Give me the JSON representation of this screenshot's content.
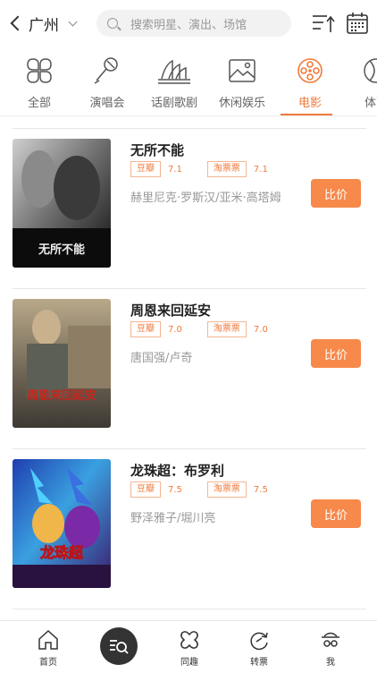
{
  "header": {
    "city": "广州",
    "search_placeholder": "搜索明星、演出、场馆"
  },
  "categories": [
    {
      "label": "全部",
      "icon": "grid-icon"
    },
    {
      "label": "演唱会",
      "icon": "microphone-icon"
    },
    {
      "label": "话剧歌剧",
      "icon": "opera-house-icon"
    },
    {
      "label": "休闲娱乐",
      "icon": "image-icon"
    },
    {
      "label": "电影",
      "icon": "film-reel-icon",
      "active": true
    },
    {
      "label": "体育",
      "icon": "ball-icon"
    }
  ],
  "movies": [
    {
      "title": "无所不能",
      "rating1_source": "豆瓣",
      "rating1_value": "7.1",
      "rating2_source": "淘票票",
      "rating2_value": "7.1",
      "cast": "赫里尼克·罗斯汉/亚米·高塔姆",
      "button": "比价",
      "poster_text": "无所不能"
    },
    {
      "title": "周恩来回延安",
      "rating1_source": "豆瓣",
      "rating1_value": "7.0",
      "rating2_source": "淘票票",
      "rating2_value": "7.0",
      "cast": "唐国强/卢奇",
      "button": "比价",
      "poster_text": "周恩来回延安"
    },
    {
      "title": "龙珠超：布罗利",
      "rating1_source": "豆瓣",
      "rating1_value": "7.5",
      "rating2_source": "淘票票",
      "rating2_value": "7.5",
      "cast": "野泽雅子/堀川亮",
      "button": "比价",
      "poster_text": "龙珠超"
    }
  ],
  "tabbar": [
    {
      "label": "首页",
      "icon": "home-icon"
    },
    {
      "label": "",
      "icon": "search-list-icon"
    },
    {
      "label": "同趣",
      "icon": "puzzle-icon"
    },
    {
      "label": "转票",
      "icon": "refresh-ticket-icon"
    },
    {
      "label": "我",
      "icon": "user-icon"
    }
  ],
  "colors": {
    "accent": "#f07a3b",
    "button": "#f7894a"
  }
}
